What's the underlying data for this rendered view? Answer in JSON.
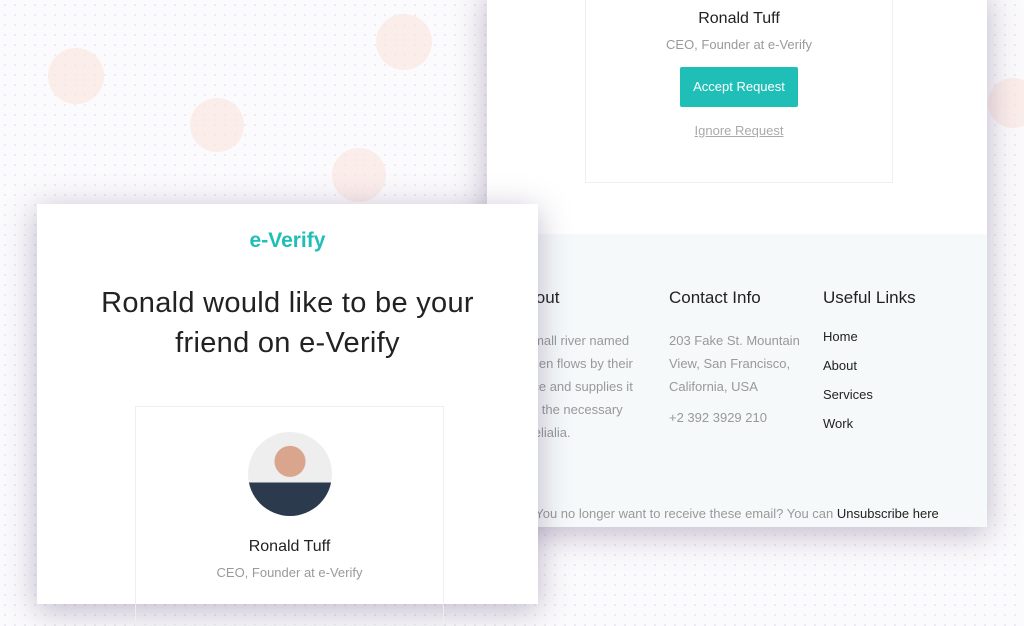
{
  "back_email": {
    "profile": {
      "name": "Ronald Tuff",
      "role": "CEO, Founder at e-Verify",
      "accept_label": "Accept Request",
      "ignore_label": "Ignore Request"
    },
    "footer": {
      "about": {
        "title": "About",
        "lines": [
          "A small river named",
          "Duden flows by their",
          "place and supplies it",
          "with the necessary",
          "regelialia."
        ]
      },
      "contact": {
        "title": "Contact Info",
        "address_lines": [
          "203 Fake St. Mountain",
          "View, San Francisco,",
          "California, USA"
        ],
        "phone": "+2 392 3929 210"
      },
      "links": {
        "title": "Useful Links",
        "items": [
          "Home",
          "About",
          "Services",
          "Work"
        ]
      },
      "unsubscribe_text": "You no longer want to receive these email? You can",
      "unsubscribe_link": "Unsubscribe here"
    }
  },
  "front_email": {
    "logo": "e-Verify",
    "headline_line1": "Ronald would like to be your",
    "headline_line2": "friend on e-Verify",
    "profile": {
      "name": "Ronald Tuff",
      "role": "CEO, Founder at e-Verify"
    }
  },
  "colors": {
    "accent": "#1fbfb8",
    "footer_bg": "#f5f9fa"
  }
}
